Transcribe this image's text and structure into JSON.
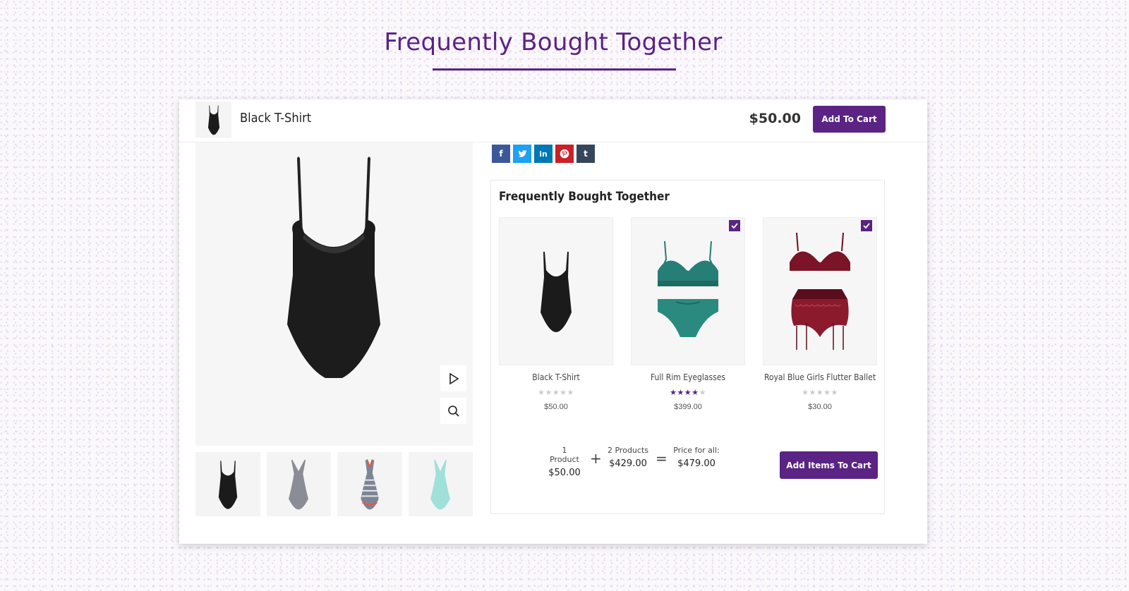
{
  "page_title": "Frequently Bought Together",
  "colors": {
    "accent": "#5a2384"
  },
  "sticky_bar": {
    "product_name": "Black T-Shirt",
    "price": "$50.00",
    "add_to_cart_label": "Add To Cart"
  },
  "gallery": {
    "controls": [
      "play-icon",
      "zoom-icon"
    ],
    "thumbnails": [
      "black bodysuit",
      "grey swimsuit",
      "striped swimsuit",
      "mint swimsuit"
    ]
  },
  "share": {
    "icons": [
      {
        "name": "facebook-icon",
        "glyph": "f",
        "color": "#3b5998"
      },
      {
        "name": "twitter-icon",
        "glyph": "t",
        "color": "#1da1f2"
      },
      {
        "name": "linkedin-icon",
        "glyph": "in",
        "color": "#0077b5"
      },
      {
        "name": "pinterest-icon",
        "glyph": "p",
        "color": "#cb2027"
      },
      {
        "name": "tumblr-icon",
        "glyph": "t",
        "color": "#35465c"
      }
    ]
  },
  "fbt": {
    "title": "Frequently Bought Together",
    "items": [
      {
        "name": "Black T-Shirt",
        "price": "$50.00",
        "rating": 0,
        "checked": false
      },
      {
        "name": "Full Rim Eyeglasses",
        "price": "$399.00",
        "rating": 4,
        "checked": true
      },
      {
        "name": "Royal Blue Girls Flutter Ballet",
        "price": "$30.00",
        "rating": 0,
        "checked": true
      }
    ],
    "summary": {
      "first_label": "1 Product",
      "first_value": "$50.00",
      "plus": "+",
      "second_label": "2 Products",
      "second_value": "$429.00",
      "equals": "=",
      "total_label": "Price for all:",
      "total_value": "$479.00"
    },
    "add_items_label": "Add Items To Cart"
  }
}
